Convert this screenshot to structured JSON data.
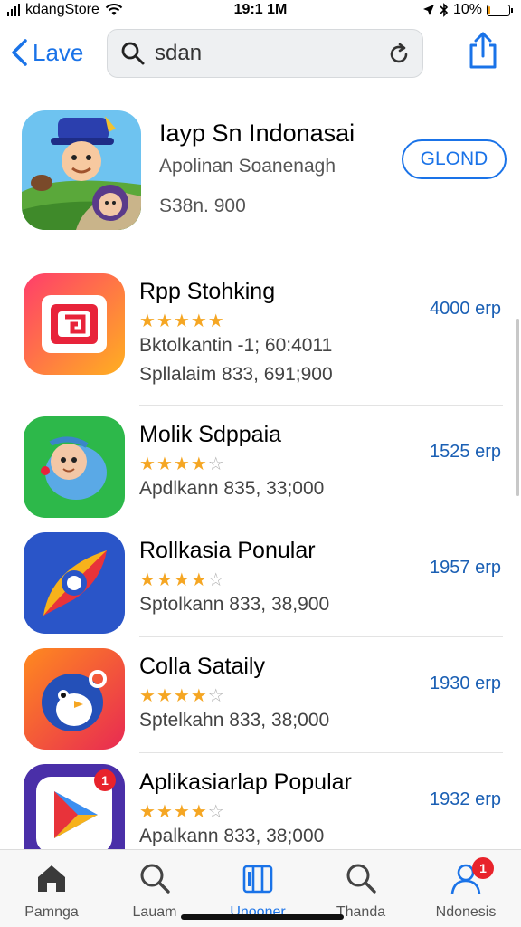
{
  "status_bar": {
    "carrier": "kdangStore",
    "time": "19:1 1M",
    "battery": "10%",
    "battery_level": 0.1
  },
  "nav": {
    "back_label": "Lave",
    "search_value": "sdan",
    "icons": {
      "back": "chevron-left-icon",
      "search": "search-icon",
      "refresh": "refresh-icon",
      "share": "share-icon"
    }
  },
  "featured": {
    "title": "Iayp Sn Indonasai",
    "subtitle": "Apolinan Soanenagh",
    "price": "S38n. 900",
    "button_label": "GLOND"
  },
  "apps": [
    {
      "name": "Rpp Stohking",
      "rating": 5,
      "meta1": "Bktolkantin  -1; 60:4011",
      "meta2": "Spllalaim  833, 691;900",
      "size": "4000 erp"
    },
    {
      "name": "Molik Sdppaia",
      "rating": 4,
      "meta1": "Apdlkann  835, 33;000",
      "size": "1525 erp"
    },
    {
      "name": "Rollkasia Ponular",
      "rating": 4,
      "meta1": "Sptolkann  833, 38,900",
      "size": "1957 erp"
    },
    {
      "name": "Colla Sataily",
      "rating": 4,
      "meta1": "Sptelkahn  833, 38;000",
      "size": "1930 erp"
    },
    {
      "name": "Aplikasiarlap Popular",
      "rating": 4,
      "meta1": "Apalkann  833, 38;000",
      "size": "1932 erp",
      "icon_badge": "1"
    }
  ],
  "tabs": [
    {
      "label": "Pamnga",
      "icon": "home-icon"
    },
    {
      "label": "Lauam",
      "icon": "search-icon"
    },
    {
      "label": "Unooner",
      "icon": "apps-icon"
    },
    {
      "label": "Thanda",
      "icon": "search-icon"
    },
    {
      "label": "Ndonesis",
      "icon": "profile-icon",
      "badge": "1"
    }
  ],
  "colors": {
    "accent": "#1a73e8",
    "star": "#f5a623",
    "badge": "#e8232b"
  }
}
